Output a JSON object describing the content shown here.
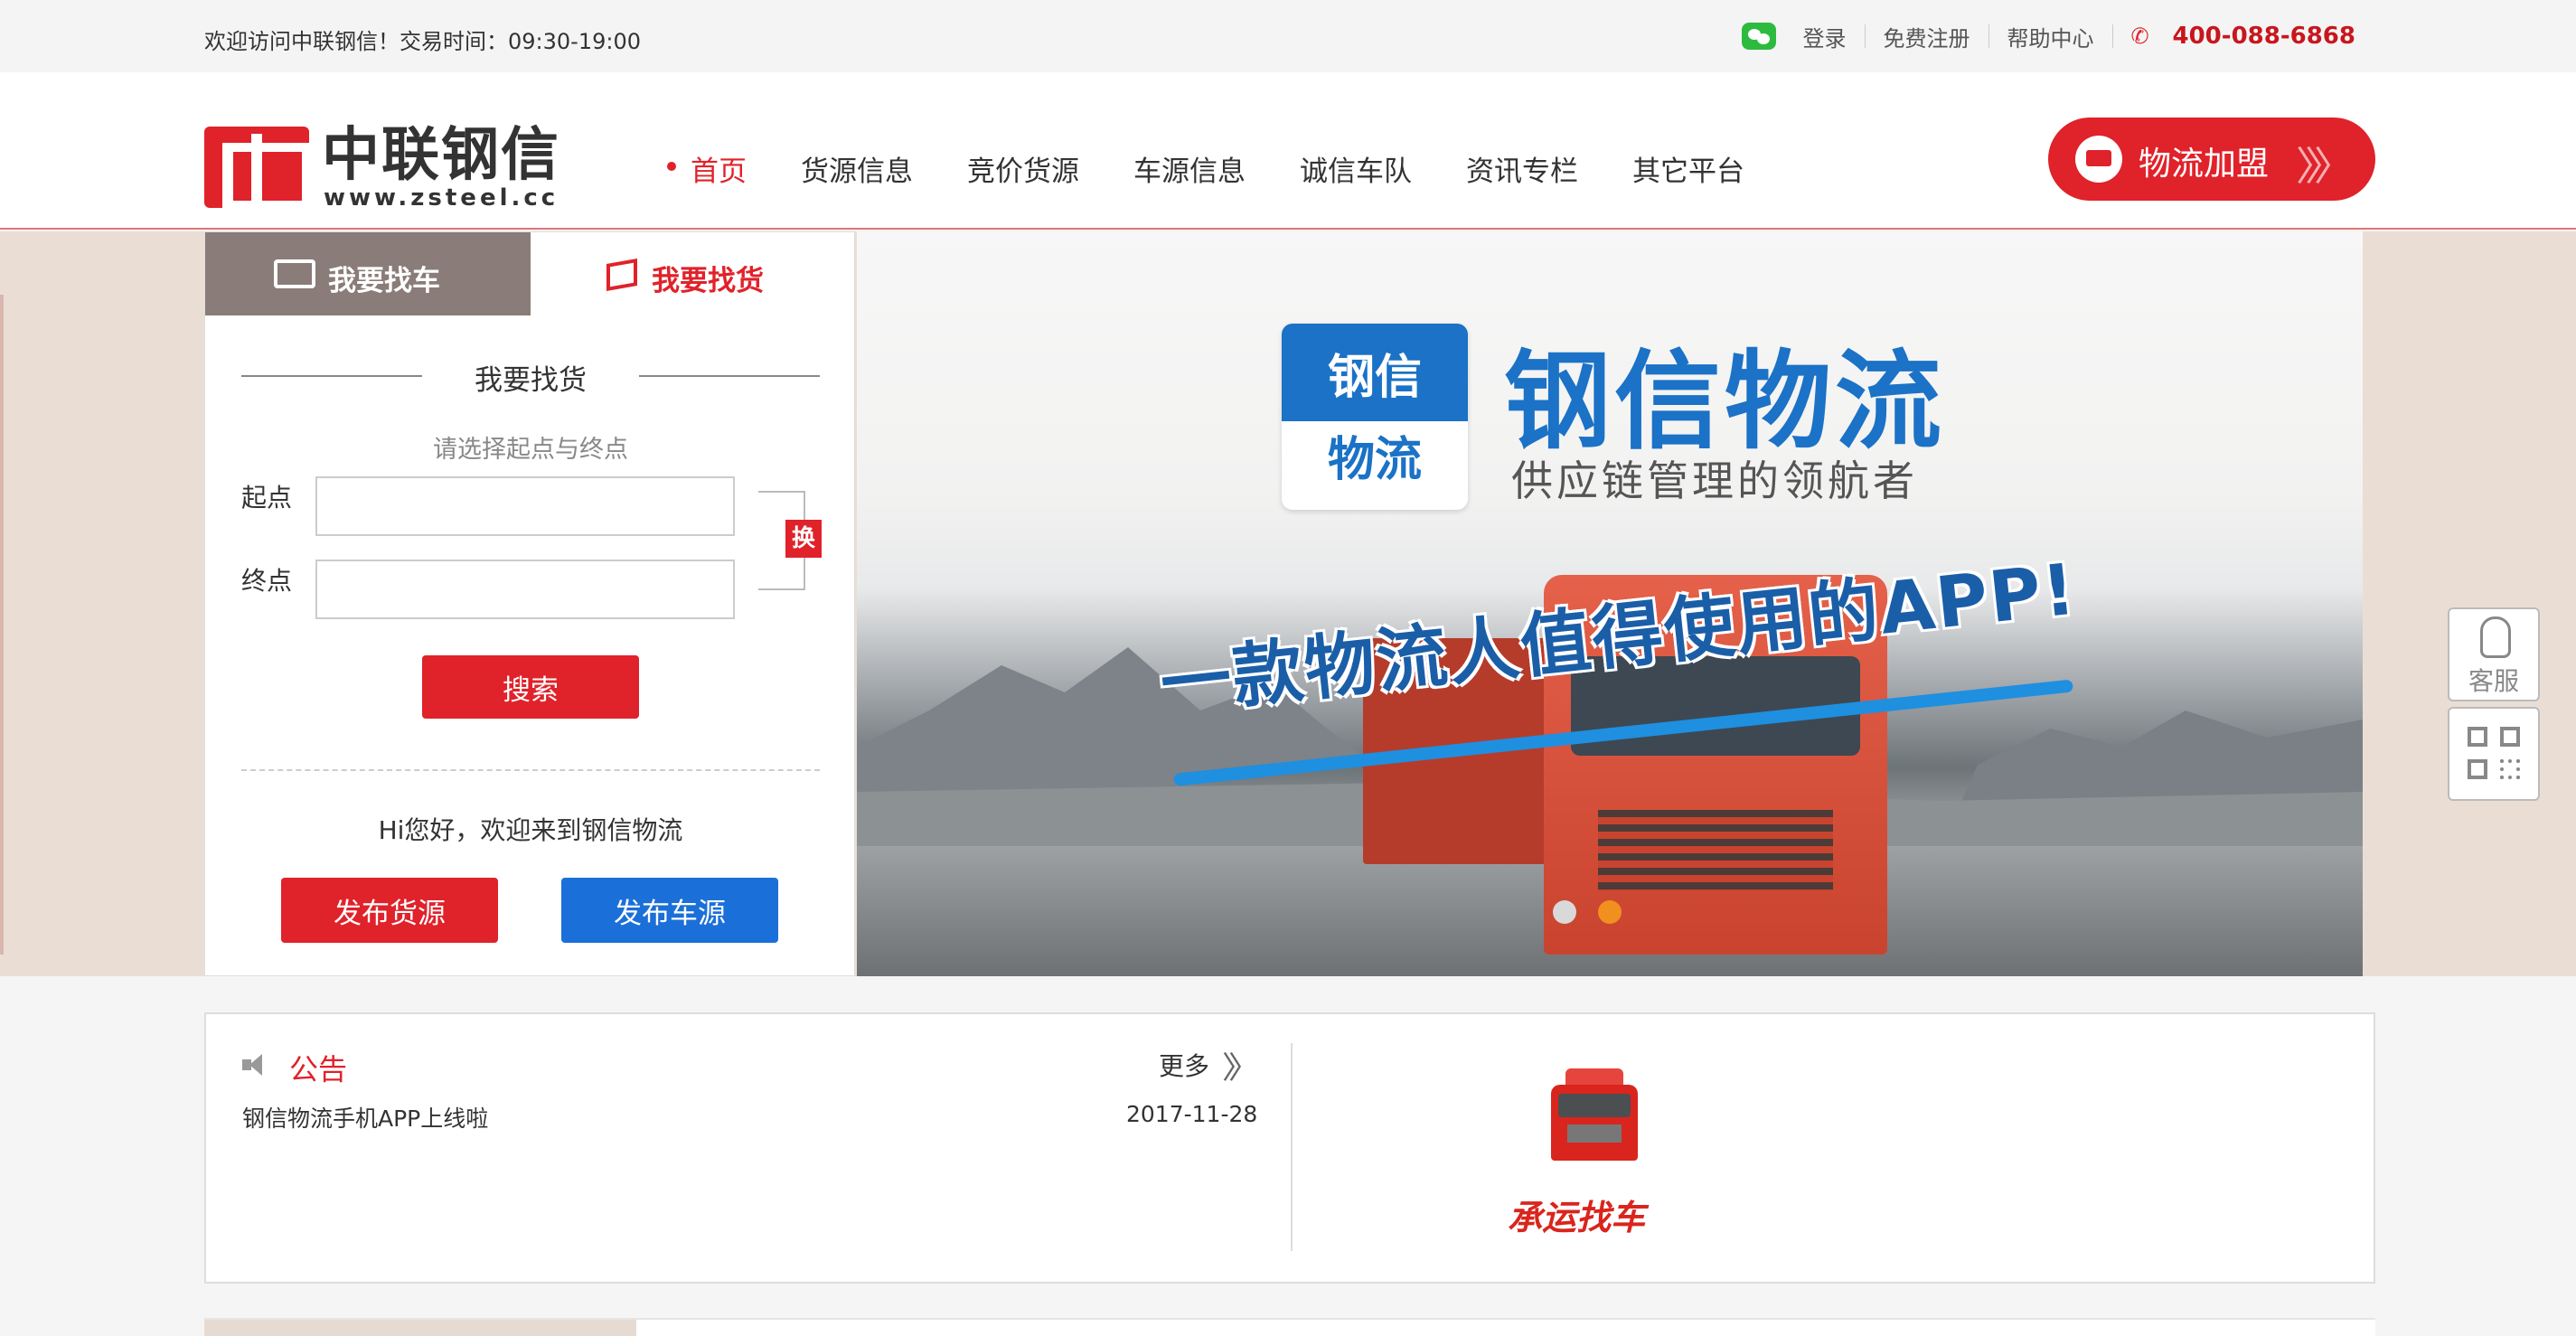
{
  "topbar": {
    "welcome": "欢迎访问中联钢信！交易时间：09:30-19:00",
    "login": "登录",
    "register": "免费注册",
    "help": "帮助中心",
    "phone": "400-088-6868",
    "icons": [
      "wechat-icon",
      "phone-icon"
    ]
  },
  "header": {
    "logo_cn": "中联钢信",
    "logo_en": "www.zsteel.cc",
    "nav": [
      {
        "label": "首页",
        "active": true
      },
      {
        "label": "货源信息"
      },
      {
        "label": "竞价货源"
      },
      {
        "label": "车源信息"
      },
      {
        "label": "诚信车队"
      },
      {
        "label": "资讯专栏"
      },
      {
        "label": "其它平台"
      }
    ],
    "join_label": "物流加盟",
    "join_arrows": "〉〉〉"
  },
  "panel": {
    "tab_car": "我要找车",
    "tab_goods": "我要找货",
    "form_title": "我要找货",
    "hint": "请选择起点与终点",
    "start_label": "起点",
    "end_label": "终点",
    "start_value": "",
    "end_value": "",
    "swap_label": "换",
    "search_label": "搜索",
    "welcome": "Hi您好，欢迎来到钢信物流",
    "publish_goods": "发布货源",
    "publish_car": "发布车源"
  },
  "banner": {
    "app_icon_top": "钢信",
    "app_icon_bottom": "物流",
    "title": "钢信物流",
    "subtitle": "供应链管理的领航者",
    "slogan": "一款物流人值得使用的APP!",
    "slide_count": 2,
    "active_slide": 2
  },
  "side": {
    "service_label": "客服"
  },
  "notice": {
    "title": "公告",
    "more": "更多",
    "more_arrows": "〉〉",
    "items": [
      {
        "text": "钢信物流手机APP上线啦",
        "date": "2017-11-28"
      }
    ],
    "promo_label": "承运找车"
  },
  "colors": {
    "brand_red": "#e0222a",
    "brand_blue": "#1b6fd8",
    "tab_grey": "#8a7c78",
    "accent_orange": "#f0901e"
  }
}
